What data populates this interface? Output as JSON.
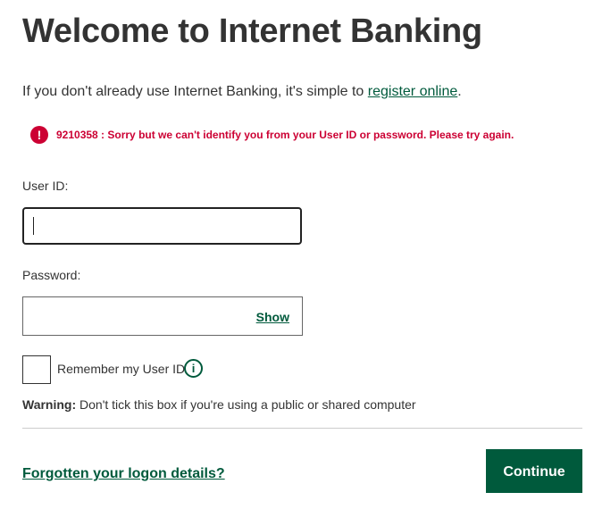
{
  "header": {
    "title": "Welcome to Internet Banking"
  },
  "intro": {
    "text": "If you don't already use Internet Banking, it's simple to ",
    "link": "register online",
    "suffix": "."
  },
  "error": {
    "icon": "!",
    "message": "9210358 : Sorry but we can't identify you from your User ID or password. Please try again.",
    "color": "#cc0033"
  },
  "form": {
    "userid_label": "User ID:",
    "userid_value": "",
    "password_label": "Password:",
    "password_value": "",
    "show_label": "Show",
    "remember_label": "Remember my User ID",
    "remember_checked": false,
    "info_icon": "i",
    "warning_bold": "Warning:",
    "warning_text": " Don't tick this box if you're using a public or shared computer"
  },
  "footer": {
    "forgot_link": "Forgotten your logon details?",
    "continue_label": "Continue"
  },
  "colors": {
    "brand_green": "#005a3c",
    "text": "#333333"
  }
}
